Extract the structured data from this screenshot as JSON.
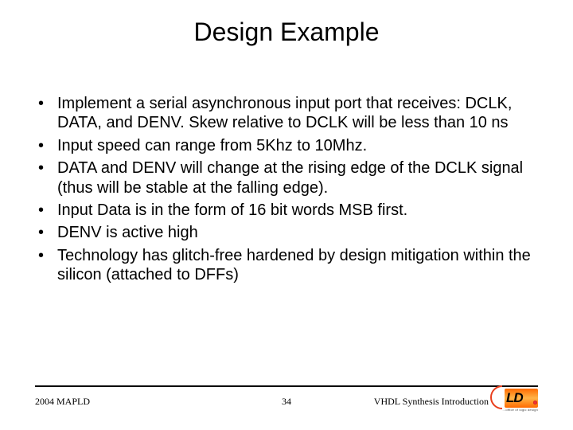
{
  "title": "Design Example",
  "bullets": [
    "Implement a serial asynchronous input port that receives: DCLK, DATA, and DENV. Skew relative to DCLK will be less than 10 ns",
    "Input speed can range from 5Khz to 10Mhz.",
    "DATA and DENV will change at the rising edge of the DCLK signal (thus will be stable at the falling edge).",
    "Input Data is in the form of 16 bit words MSB first.",
    "DENV is active high",
    "Technology has glitch-free hardened by design mitigation within the silicon (attached to DFFs)"
  ],
  "footer": {
    "left": "2004 MAPLD",
    "center": "34",
    "right": "VHDL Synthesis Introduction"
  },
  "logo": {
    "text": "LD",
    "tagline": "...office of logic design"
  }
}
